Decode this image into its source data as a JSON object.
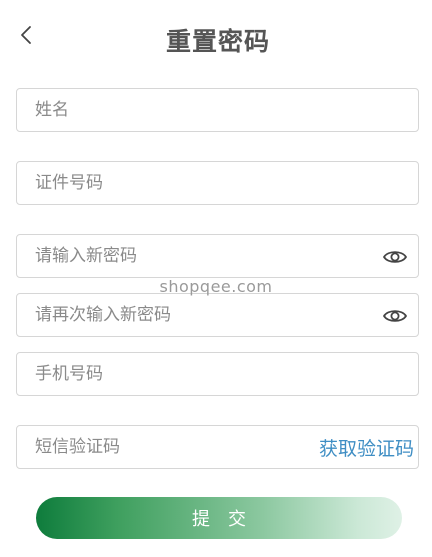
{
  "header": {
    "title": "重置密码"
  },
  "form": {
    "name": {
      "placeholder": "姓名",
      "value": ""
    },
    "id_number": {
      "placeholder": "证件号码",
      "value": ""
    },
    "new_password": {
      "placeholder": "请输入新密码",
      "value": ""
    },
    "confirm_password": {
      "placeholder": "请再次输入新密码",
      "value": ""
    },
    "phone": {
      "placeholder": "手机号码",
      "value": ""
    },
    "sms_code": {
      "placeholder": "短信验证码",
      "value": "",
      "get_code_label": "获取验证码"
    }
  },
  "submit_label": "提交",
  "watermark": "shopqee.com",
  "icons": {
    "back": "chevron-left-icon",
    "password_visibility": "eye-icon"
  },
  "colors": {
    "link": "#3f8ec4",
    "button_start": "#0e7c3c",
    "button_end": "#dff1e6",
    "title": "#555555",
    "border": "#d6d6d6"
  }
}
